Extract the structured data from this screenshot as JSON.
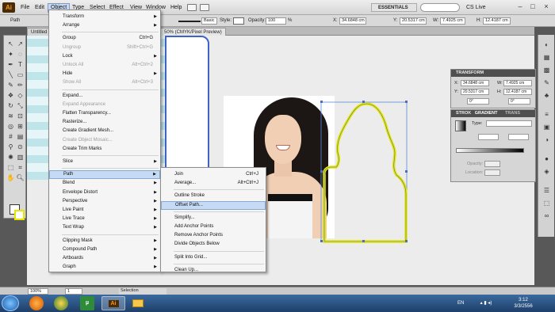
{
  "menubar": {
    "app_icon": "Ai",
    "items": [
      "File",
      "Edit",
      "Object",
      "Type",
      "Select",
      "Effect",
      "View",
      "Window",
      "Help"
    ],
    "active_item": "Object",
    "workspace": "ESSENTIALS",
    "cs_live": "CS Live"
  },
  "control_bar": {
    "selection_label": "Path",
    "brush_label": "Basic",
    "style_label": "Style:",
    "opacity_label": "Opacity:",
    "opacity_value": "100",
    "percent": "%",
    "x_label": "X:",
    "x_value": "34.6848 cm",
    "y_label": "Y:",
    "y_value": "20.5317 cm",
    "w_label": "W:",
    "w_value": "7.4925 cm",
    "h_label": "H:",
    "h_value": "12.4187 cm"
  },
  "document": {
    "tab_left": "Untitled",
    "tab_main": "50% (CMYK/Pixel Preview)"
  },
  "object_menu": [
    {
      "label": "Transform",
      "shortcut": "",
      "submenu": true,
      "disabled": false
    },
    {
      "label": "Arrange",
      "shortcut": "",
      "submenu": true,
      "disabled": false
    },
    {
      "sep": true
    },
    {
      "label": "Group",
      "shortcut": "Ctrl+G",
      "submenu": false,
      "disabled": false
    },
    {
      "label": "Ungroup",
      "shortcut": "Shift+Ctrl+G",
      "submenu": false,
      "disabled": true
    },
    {
      "label": "Lock",
      "shortcut": "",
      "submenu": true,
      "disabled": false
    },
    {
      "label": "Unlock All",
      "shortcut": "Alt+Ctrl+2",
      "submenu": false,
      "disabled": true
    },
    {
      "label": "Hide",
      "shortcut": "",
      "submenu": true,
      "disabled": false
    },
    {
      "label": "Show All",
      "shortcut": "Alt+Ctrl+3",
      "submenu": false,
      "disabled": true
    },
    {
      "sep": true
    },
    {
      "label": "Expand...",
      "shortcut": "",
      "submenu": false,
      "disabled": false
    },
    {
      "label": "Expand Appearance",
      "shortcut": "",
      "submenu": false,
      "disabled": true
    },
    {
      "label": "Flatten Transparency...",
      "shortcut": "",
      "submenu": false,
      "disabled": false
    },
    {
      "label": "Rasterize...",
      "shortcut": "",
      "submenu": false,
      "disabled": false
    },
    {
      "label": "Create Gradient Mesh...",
      "shortcut": "",
      "submenu": false,
      "disabled": false
    },
    {
      "label": "Create Object Mosaic...",
      "shortcut": "",
      "submenu": false,
      "disabled": true
    },
    {
      "label": "Create Trim Marks",
      "shortcut": "",
      "submenu": false,
      "disabled": false
    },
    {
      "sep": true
    },
    {
      "label": "Slice",
      "shortcut": "",
      "submenu": true,
      "disabled": false
    },
    {
      "sep": true
    },
    {
      "label": "Path",
      "shortcut": "",
      "submenu": true,
      "disabled": false,
      "highlighted": true
    },
    {
      "label": "Blend",
      "shortcut": "",
      "submenu": true,
      "disabled": false
    },
    {
      "label": "Envelope Distort",
      "shortcut": "",
      "submenu": true,
      "disabled": false
    },
    {
      "label": "Perspective",
      "shortcut": "",
      "submenu": true,
      "disabled": false
    },
    {
      "label": "Live Paint",
      "shortcut": "",
      "submenu": true,
      "disabled": false
    },
    {
      "label": "Live Trace",
      "shortcut": "",
      "submenu": true,
      "disabled": false
    },
    {
      "label": "Text Wrap",
      "shortcut": "",
      "submenu": true,
      "disabled": false
    },
    {
      "sep": true
    },
    {
      "label": "Clipping Mask",
      "shortcut": "",
      "submenu": true,
      "disabled": false
    },
    {
      "label": "Compound Path",
      "shortcut": "",
      "submenu": true,
      "disabled": false
    },
    {
      "label": "Artboards",
      "shortcut": "",
      "submenu": true,
      "disabled": false
    },
    {
      "label": "Graph",
      "shortcut": "",
      "submenu": true,
      "disabled": false
    }
  ],
  "path_submenu": [
    {
      "label": "Join",
      "shortcut": "Ctrl+J"
    },
    {
      "label": "Average...",
      "shortcut": "Alt+Ctrl+J"
    },
    {
      "sep": true
    },
    {
      "label": "Outline Stroke",
      "shortcut": ""
    },
    {
      "label": "Offset Path...",
      "shortcut": "",
      "highlighted": true
    },
    {
      "sep": true
    },
    {
      "label": "Simplify...",
      "shortcut": ""
    },
    {
      "label": "Add Anchor Points",
      "shortcut": ""
    },
    {
      "label": "Remove Anchor Points",
      "shortcut": ""
    },
    {
      "label": "Divide Objects Below",
      "shortcut": ""
    },
    {
      "sep": true
    },
    {
      "label": "Split Into Grid...",
      "shortcut": ""
    },
    {
      "sep": true
    },
    {
      "label": "Clean Up...",
      "shortcut": ""
    }
  ],
  "transform_panel": {
    "title": "TRANSFORM",
    "x_label": "X:",
    "x_value": "34.6848 cm",
    "y_label": "Y:",
    "y_value": "20.5317 cm",
    "w_label": "W:",
    "w_value": "7.4925 cm",
    "h_label": "H:",
    "h_value": "12.4187 cm",
    "rotate": "0°",
    "shear": "0°"
  },
  "gradient_panel": {
    "tab_stroke": "STROK",
    "tab_gradient": "GRADIENT",
    "tab_trans": "TRANS",
    "type_label": "Type:",
    "opacity_label": "Opacity:",
    "location_label": "Location:"
  },
  "status_bar": {
    "zoom": "100%",
    "page": "1",
    "tool": "Selection"
  },
  "taskbar": {
    "language": "EN",
    "time": "3:12",
    "date": "3/3/2556"
  },
  "colors": {
    "path_outline": "#e6e600",
    "selection_blue": "#3e63c8",
    "menu_highlight": "#c6dbf3"
  }
}
